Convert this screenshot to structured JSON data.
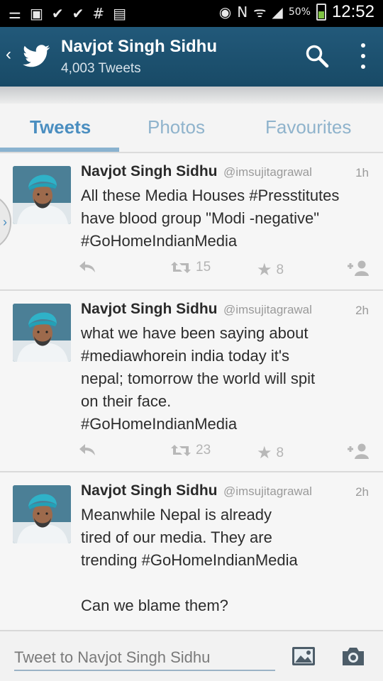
{
  "status_bar": {
    "left_icons": [
      "minus-list-icon",
      "image-icon",
      "check-icon",
      "check-icon",
      "hash-icon",
      "clipboard-check-icon"
    ],
    "right_icons": [
      "eye-icon",
      "nfc-icon",
      "wifi-icon",
      "signal-icon"
    ],
    "battery_percent": "50%",
    "battery_level": 0.5,
    "time": "12:52"
  },
  "action_bar": {
    "title": "Navjot Singh Sidhu",
    "subtitle": "4,003 Tweets",
    "accent": "#1d4e6b"
  },
  "tabs": [
    {
      "label": "Tweets",
      "active": true
    },
    {
      "label": "Photos",
      "active": false
    },
    {
      "label": "Favourites",
      "active": false
    }
  ],
  "tweets": [
    {
      "name": "Navjot Singh Sidhu",
      "handle": "@imsujitagrawal",
      "time": "1h",
      "lines": [
        "All these Media Houses  #Presstitutes",
        "have blood group \"Modi -negative\"",
        " #GoHomeIndianMedia"
      ],
      "retweets": "15",
      "favorites": "8"
    },
    {
      "name": "Navjot Singh Sidhu",
      "handle": "@imsujitagrawal",
      "time": "2h",
      "lines": [
        "what we have been saying about",
        "#mediawhorein india today it's",
        "nepal; tomorrow the world will spit",
        "on their face.",
        " #GoHomeIndianMedia"
      ],
      "retweets": "23",
      "favorites": "8"
    },
    {
      "name": "Navjot Singh Sidhu",
      "handle": "@imsujitagrawal",
      "time": "2h",
      "lines": [
        "Meanwhile Nepal is already",
        "tired of our media. They are",
        "trending #GoHomeIndianMedia",
        "",
        "Can we blame them?"
      ]
    }
  ],
  "side_tab": {
    "glyph": "›"
  },
  "compose": {
    "placeholder": "Tweet to Navjot Singh Sidhu"
  }
}
